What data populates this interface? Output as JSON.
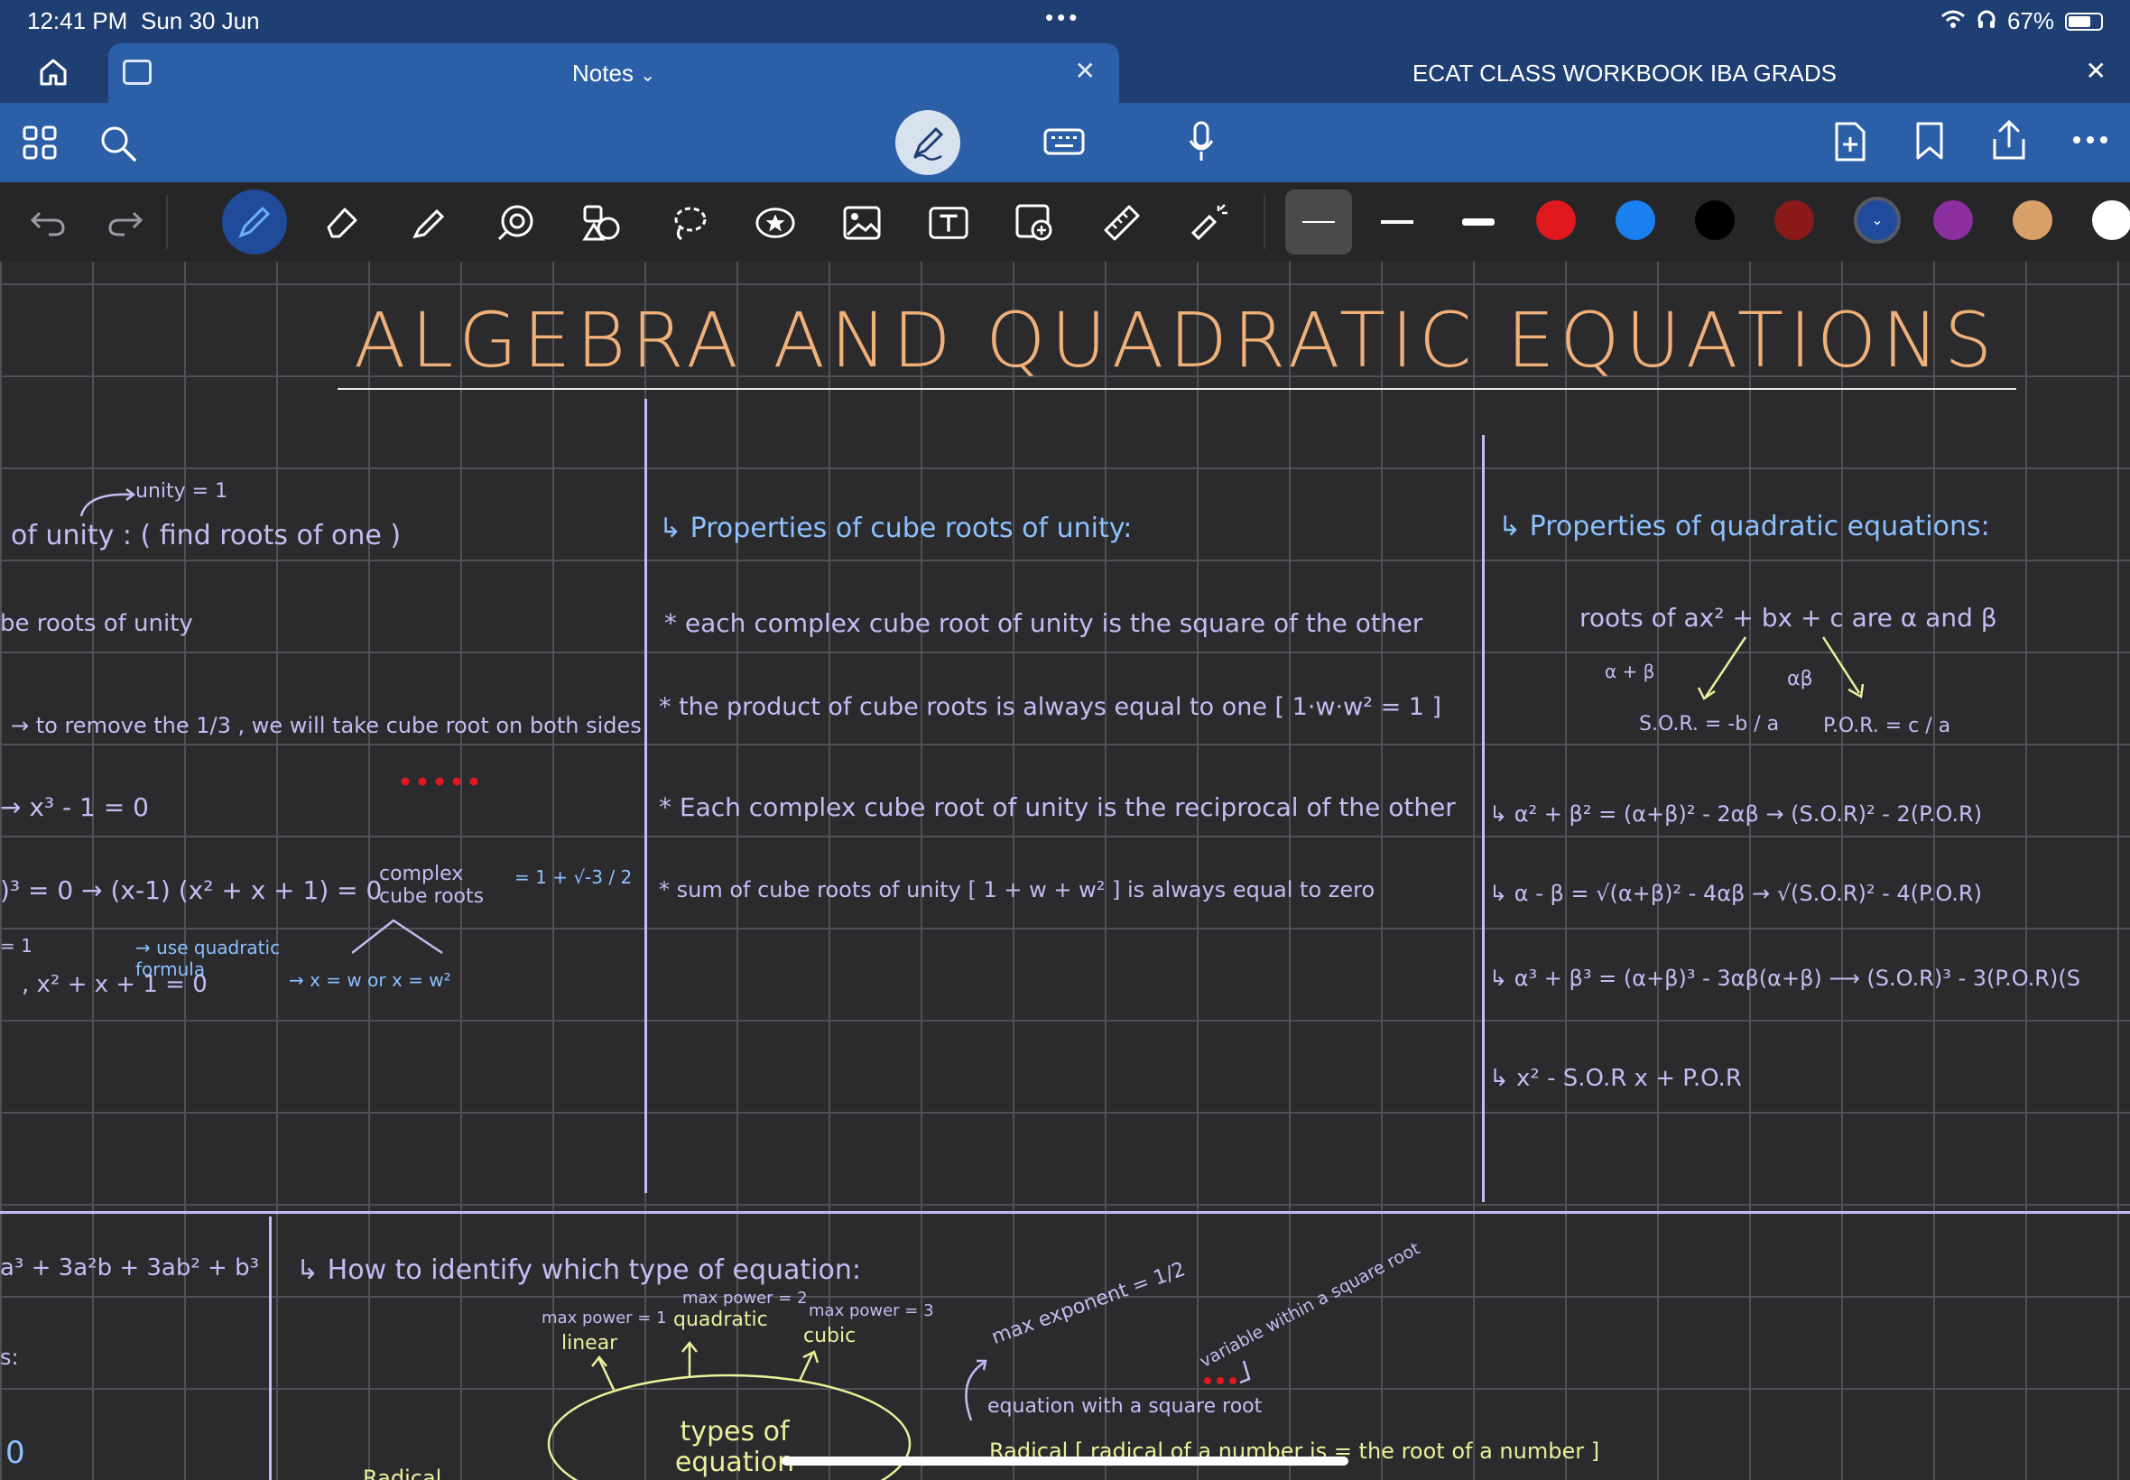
{
  "status_bar": {
    "time": "12:41 PM",
    "date": "Sun 30 Jun",
    "battery": "67%",
    "battery_level": 0.67
  },
  "tabs": [
    {
      "label": "Notes",
      "active": true
    },
    {
      "label": "ECAT CLASS WORKBOOK IBA GRADS",
      "active": false
    }
  ],
  "toolbar": {
    "left_icons": [
      "grid-icon",
      "search-icon"
    ],
    "center_icons": [
      "pen-mode-icon",
      "keyboard-icon",
      "microphone-icon"
    ],
    "right_icons": [
      "add-page-icon",
      "bookmark-icon",
      "share-icon",
      "more-icon"
    ]
  },
  "tools": [
    "undo-icon",
    "redo-icon",
    "pen-icon",
    "eraser-icon",
    "highlighter-icon",
    "shapes-icon",
    "elements-icon",
    "lasso-icon",
    "sticker-icon",
    "image-icon",
    "text-icon",
    "camera-icon",
    "ruler-icon",
    "laser-pointer-icon"
  ],
  "colors": {
    "accent": "#2b5fa8",
    "status": "#1f3f73",
    "swatches": [
      "#e0191e",
      "#1a80f0",
      "#000000",
      "#8a1a1a",
      "#1f4b9a",
      "#8a2ea0",
      "#d9a06a",
      "#ffffff"
    ]
  },
  "note": {
    "title": "ALGEBRA AND QUADRATIC EQUATIONS",
    "col1": [
      "unity = 1",
      "of unity : ( find roots of one )",
      "be roots of unity",
      "→ to remove the 1/3 , we  will take  cube root  on  both  sides",
      "→ x³ - 1 = 0",
      ")³ = 0  → (x-1) (x² + x + 1) = 0",
      "complex cube roots",
      "= 1 + √-3 / 2",
      "= 1",
      "→ use quadratic formula",
      ",  x² + x + 1 = 0",
      "→ x = w   or x = w²"
    ],
    "col2": [
      "↳ Properties of cube roots of unity:",
      "* each complex cube root  of unity is the  square of the  other",
      "* the product of cube roots  is  always  equal  to one [ 1·w·w² = 1 ]",
      "* Each  complex  cube root  of unity is the  reciprocal of the  other",
      "* sum of cube roots  of unity [ 1 + w + w² ] is always  equal  to zero"
    ],
    "col3": [
      "↳ Properties of quadratic equations:",
      "roots of  ax² + bx + c  are  α and β",
      "α + β",
      "S.O.R. = -b / a",
      "αβ",
      "P.O.R. = c / a",
      "↳ α² + β² = (α+β)² - 2αβ → (S.O.R)² - 2(P.O.R)",
      "↳ α - β = √(α+β)² - 4αβ → √(S.O.R)² - 4(P.O.R)",
      "↳ α³ + β³ = (α+β)³ - 3αβ(α+β) ⟶ (S.O.R)³ - 3(P.O.R)(S",
      "↳ x² - S.O.R x + P.O.R"
    ],
    "bottom_left": [
      "a³ + 3a²b + 3ab² + b³",
      "s:",
      "0"
    ],
    "bottom": {
      "heading": "↳ How to identify which type  of equation:",
      "center": "types of equation",
      "linear_note": "max power = 1",
      "linear": "linear",
      "quadratic_note": "max power = 2",
      "quadratic": "quadratic",
      "cubic_note": "max power = 3",
      "cubic": "cubic",
      "radical_note": "max exponent = 1/2",
      "radical_desc": "equation with a square root",
      "variable_note": "variable within a square root",
      "radical_def": "Radical [ radical of a number is = the root of a number ]",
      "radical_left": "Radical"
    }
  }
}
